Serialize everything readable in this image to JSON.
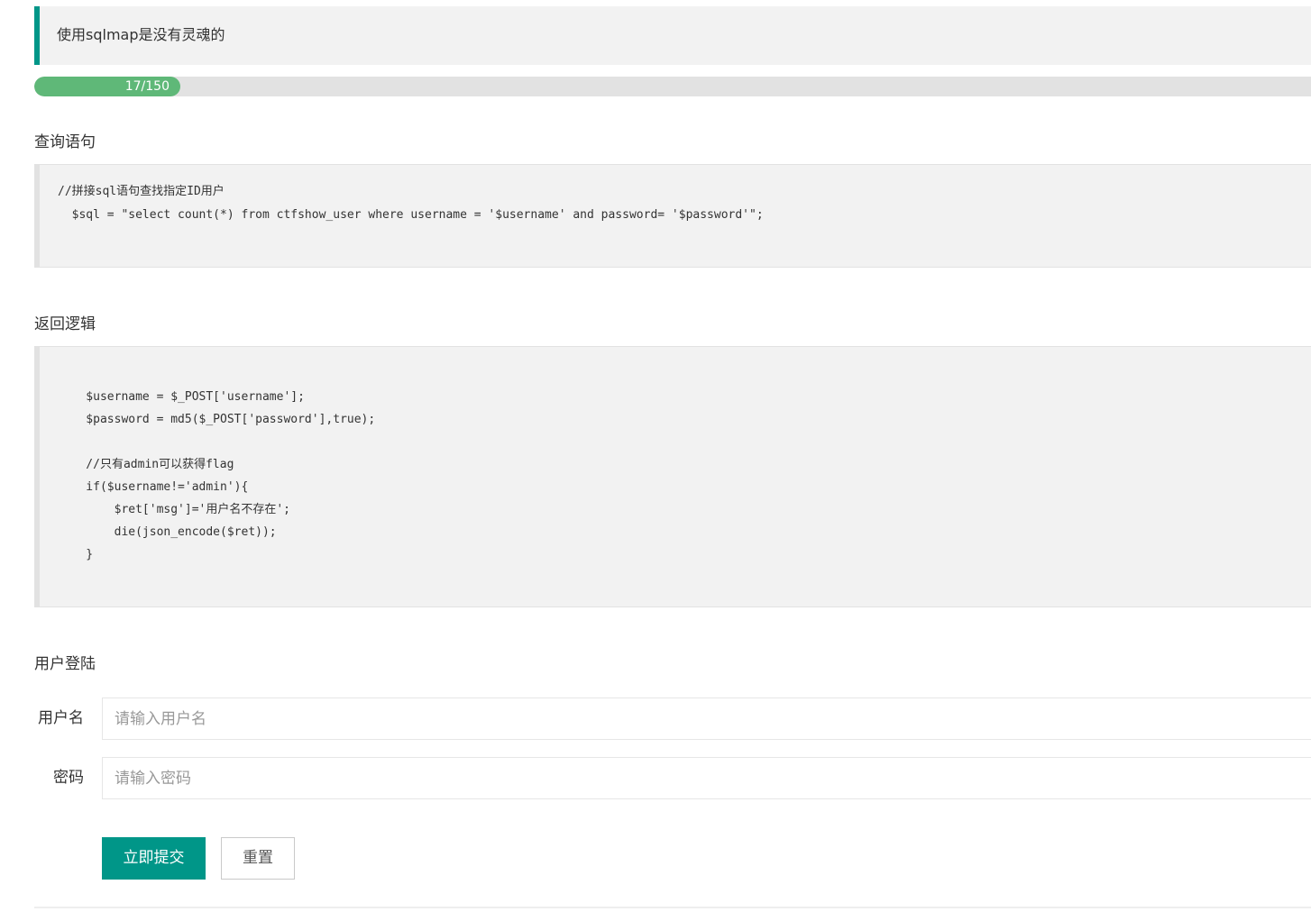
{
  "quote": {
    "text": "使用sqlmap是没有灵魂的"
  },
  "progress": {
    "label": "17/150",
    "value": 17,
    "total": 150
  },
  "query_section": {
    "title": "查询语句",
    "lines": [
      "//拼接sql语句查找指定ID用户",
      "  $sql = \"select count(*) from ctfshow_user where username = '$username' and password= '$password'\";"
    ]
  },
  "logic_section": {
    "title": "返回逻辑",
    "lines": [
      "    $username = $_POST['username'];",
      "    $password = md5($_POST['password'],true);",
      "",
      "    //只有admin可以获得flag",
      "    if($username!='admin'){",
      "        $ret['msg']='用户名不存在';",
      "        die(json_encode($ret));",
      "    }"
    ]
  },
  "login": {
    "title": "用户登陆",
    "username_label": "用户名",
    "username_placeholder": "请输入用户名",
    "username_value": "",
    "password_label": "密码",
    "password_placeholder": "请输入密码",
    "password_value": "",
    "submit_label": "立即提交",
    "reset_label": "重置"
  },
  "colors": {
    "accent": "#009688",
    "progress_fill": "#5fb878",
    "block_bg": "#f2f2f2"
  }
}
